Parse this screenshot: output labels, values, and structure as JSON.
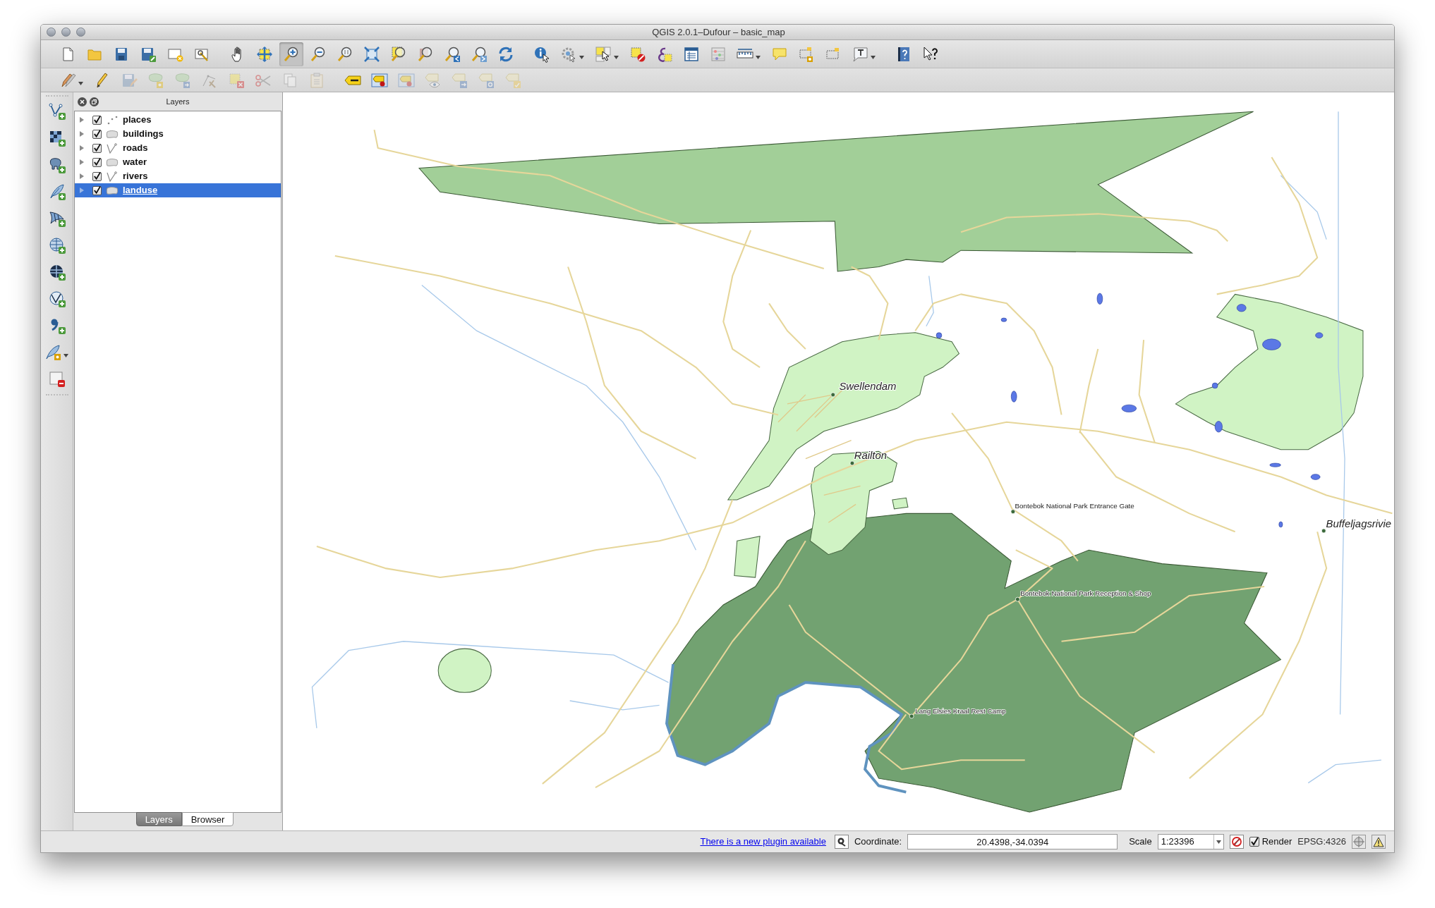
{
  "window": {
    "title": "QGIS 2.0.1–Dufour – basic_map"
  },
  "toolbar_1": {
    "groups": [
      [
        {
          "kind": "new-file",
          "selected": false
        },
        {
          "kind": "open-folder",
          "selected": false
        },
        {
          "kind": "save",
          "selected": false
        },
        {
          "kind": "save-as",
          "selected": false
        },
        {
          "kind": "new-layout",
          "selected": false
        },
        {
          "kind": "layout-manager",
          "selected": false
        }
      ],
      [
        {
          "kind": "pan",
          "selected": false
        },
        {
          "kind": "pan-selection",
          "selected": false
        },
        {
          "kind": "zoom-in",
          "selected": true
        },
        {
          "kind": "zoom-out",
          "selected": false
        },
        {
          "kind": "zoom-actual",
          "selected": false
        },
        {
          "kind": "zoom-full",
          "selected": false
        },
        {
          "kind": "zoom-selection",
          "selected": false
        },
        {
          "kind": "zoom-layer",
          "selected": false
        },
        {
          "kind": "zoom-last",
          "selected": false
        },
        {
          "kind": "zoom-next",
          "selected": false
        },
        {
          "kind": "refresh",
          "selected": false
        }
      ],
      [
        {
          "kind": "identify",
          "selected": false
        },
        {
          "kind": "run-action",
          "selected": false
        },
        {
          "kind": "select",
          "selected": false
        },
        {
          "kind": "deselect",
          "selected": false
        },
        {
          "kind": "select-expression",
          "selected": false
        },
        {
          "kind": "attribute-table",
          "selected": false
        },
        {
          "kind": "statistics",
          "selected": false
        },
        {
          "kind": "measure",
          "selected": false
        },
        {
          "kind": "tips-bubble",
          "selected": false
        },
        {
          "kind": "new-annotation",
          "selected": false
        },
        {
          "kind": "move-annotation",
          "selected": false
        },
        {
          "kind": "text-annotation",
          "selected": false
        }
      ],
      [
        {
          "kind": "help",
          "selected": false
        },
        {
          "kind": "whats-this",
          "selected": false
        }
      ]
    ]
  },
  "toolbar_2": {
    "groups": [
      [
        {
          "kind": "toggle-edit",
          "disabled": false
        },
        {
          "kind": "pencil",
          "disabled": false
        },
        {
          "kind": "save-edits",
          "disabled": true
        },
        {
          "kind": "add-feature",
          "disabled": true
        },
        {
          "kind": "move-feature",
          "disabled": true
        },
        {
          "kind": "node-tool",
          "disabled": true
        },
        {
          "kind": "delete-selected",
          "disabled": true
        },
        {
          "kind": "cut",
          "disabled": true
        },
        {
          "kind": "copy",
          "disabled": true
        },
        {
          "kind": "paste",
          "disabled": true
        }
      ],
      [
        {
          "kind": "label",
          "disabled": false
        },
        {
          "kind": "label-pin",
          "disabled": false
        },
        {
          "kind": "label-pin",
          "disabled": true
        },
        {
          "kind": "label-show",
          "disabled": true
        },
        {
          "kind": "label-move",
          "disabled": true
        },
        {
          "kind": "label-rotate",
          "disabled": true
        },
        {
          "kind": "label-change",
          "disabled": true
        }
      ]
    ]
  },
  "left_toolbar": [
    {
      "kind": "add-vector"
    },
    {
      "kind": "add-raster"
    },
    {
      "kind": "add-postgis"
    },
    {
      "kind": "add-spatialite"
    },
    {
      "kind": "add-mssql"
    },
    {
      "kind": "add-wms"
    },
    {
      "kind": "add-wcs"
    },
    {
      "kind": "add-wfs"
    },
    {
      "kind": "add-delimited"
    },
    {
      "kind": "new-layer"
    },
    {
      "kind": "remove-layer"
    }
  ],
  "layers_panel": {
    "title": "Layers",
    "layers": [
      {
        "name": "places",
        "kind": "point",
        "checked": true,
        "expanded": false,
        "selected": false
      },
      {
        "name": "buildings",
        "kind": "polygon",
        "checked": true,
        "expanded": false,
        "selected": false
      },
      {
        "name": "roads",
        "kind": "line",
        "checked": true,
        "expanded": false,
        "selected": false
      },
      {
        "name": "water",
        "kind": "polygon",
        "checked": true,
        "expanded": false,
        "selected": false
      },
      {
        "name": "rivers",
        "kind": "line",
        "checked": true,
        "expanded": false,
        "selected": false
      },
      {
        "name": "landuse",
        "kind": "polygon",
        "checked": true,
        "expanded": false,
        "selected": true
      }
    ],
    "tabs": [
      {
        "label": "Layers",
        "selected": true
      },
      {
        "label": "Browser",
        "selected": false
      }
    ]
  },
  "map": {
    "labels": [
      {
        "text": "Swellendam",
        "kind": "town"
      },
      {
        "text": "Railton",
        "kind": "town"
      },
      {
        "text": "Bontebok National Park Entrance Gate",
        "kind": "poi"
      },
      {
        "text": "Bontebok National Park Reception & Shop",
        "kind": "poi"
      },
      {
        "text": "Lang Elsies Kraal Rest Camp",
        "kind": "poi"
      },
      {
        "text": "Buffeljagsrivie",
        "kind": "town"
      }
    ]
  },
  "status_bar": {
    "message": "There is a new plugin available",
    "coordinate_label": "Coordinate:",
    "coordinate": "20.4398,-34.0394",
    "scale_label": "Scale",
    "scale": "1:23396",
    "render_checked": true,
    "render_label": "Render",
    "crs": "EPSG:4326"
  }
}
